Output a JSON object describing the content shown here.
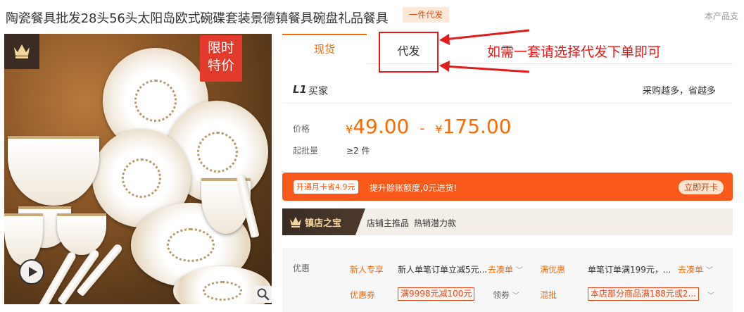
{
  "header": {
    "title": "陶瓷餐具批发28头56头太阳岛欧式碗碟套装景德镇餐具碗盘礼品餐具",
    "dropship_badge": "一件代发",
    "note": "本产品支"
  },
  "image": {
    "promo_tag_line1": "限时",
    "promo_tag_line2": "特价",
    "crown_icon": "crown-icon",
    "play_icon": "play-icon",
    "zoom_icon": "zoom-icon"
  },
  "tabs": [
    {
      "label": "现货",
      "active": true
    },
    {
      "label": "代发",
      "active": false
    }
  ],
  "annotation": {
    "text": "如需一套请选择代发下单即可",
    "color": "#e21b1b"
  },
  "buyer": {
    "badge": "L1",
    "label": "买家",
    "slogan": "采购越多，省越多"
  },
  "price": {
    "label": "价格",
    "currency": "¥",
    "low": "49.00",
    "sep": "-",
    "high": "175.00"
  },
  "min_qty": {
    "label": "起批量",
    "value": "≥2 件"
  },
  "card_banner": {
    "tag": "开通月卡省4.9元",
    "promo": "提升赊账额度,0元进货!",
    "button": "立即开卡",
    "color": "#f95a1c"
  },
  "shop_banner": {
    "logo": "镇店之宝",
    "tags": [
      "店铺主推品",
      "热销潜力款"
    ]
  },
  "offers": {
    "label": "优惠",
    "row1": [
      {
        "name": "新人专享",
        "desc": "新人单笔订单立减5元...",
        "link": "去凑单"
      },
      {
        "name": "满优惠",
        "desc": "单笔订单满199元，...",
        "link": "去凑单"
      }
    ],
    "row2": [
      {
        "name": "优惠券",
        "coupon": "满9998元减100元",
        "link": "领券"
      },
      {
        "name": "混批",
        "coupon": "本店部分商品满188元或2...",
        "link": ""
      }
    ]
  },
  "colors": {
    "accent": "#ff6a00",
    "annotation_red": "#e21b1b"
  }
}
